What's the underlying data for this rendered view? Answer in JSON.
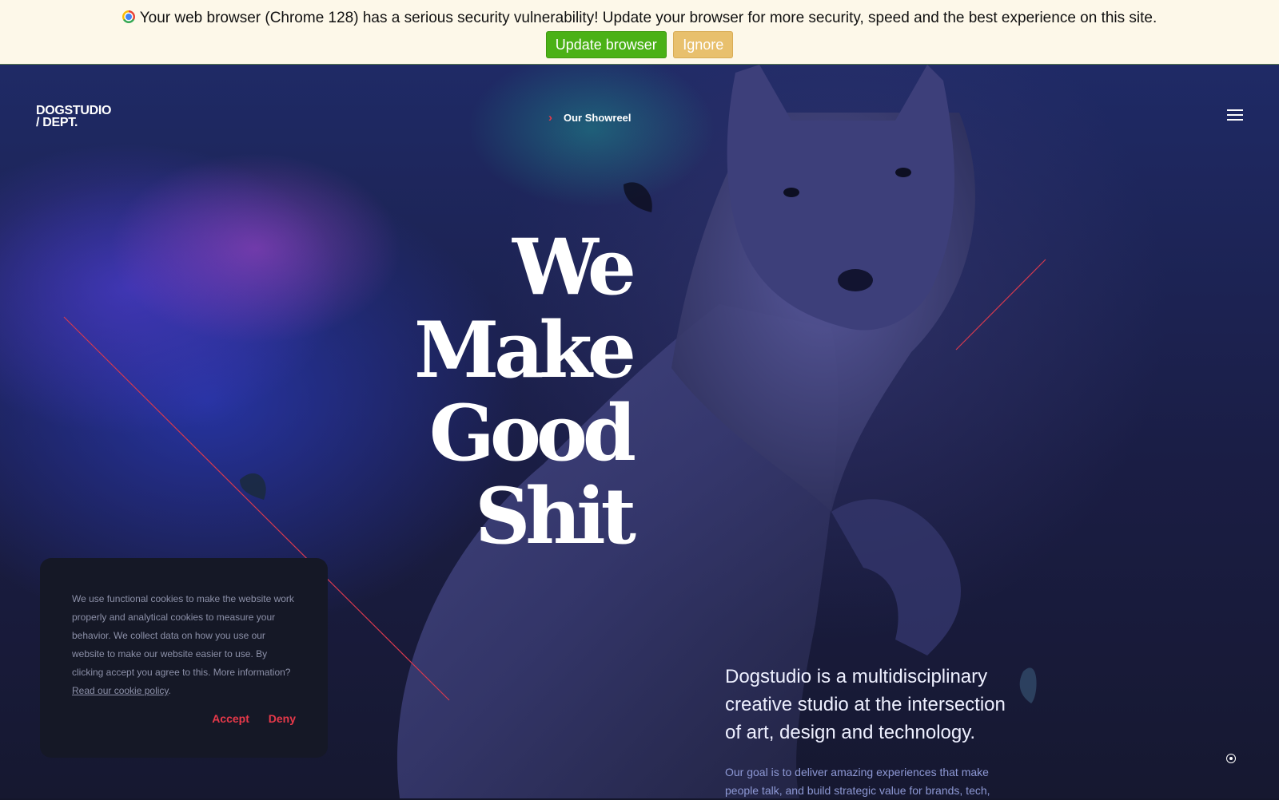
{
  "banner": {
    "message": "Your web browser (Chrome 128) has a serious security vulnerability! Update your browser for more security, speed and the best experience on this site.",
    "update_label": "Update browser",
    "ignore_label": "Ignore"
  },
  "header": {
    "logo_line1": "DOGSTUDIO",
    "logo_line2": "/ DEPT.",
    "showreel_label": "Our Showreel",
    "menu_icon": "hamburger-icon"
  },
  "hero": {
    "headline": [
      "We",
      "Make",
      "Good",
      "Shit"
    ],
    "intro": "Dogstudio is a multidisciplinary creative studio at the intersection of art, design and technology.",
    "sub_text": "Our goal is to deliver amazing experiences that make people talk, and build strategic value for brands, tech,"
  },
  "cookie": {
    "text": "We use functional cookies to make the website work properly and analytical cookies to measure your behavior. We collect data on how you use our website to make our website easier to use. By clicking accept you agree to this. More information?",
    "link_label": "Read our cookie policy",
    "accept_label": "Accept",
    "deny_label": "Deny"
  },
  "colors": {
    "accent": "#e8394a",
    "update_button": "#4bb116",
    "ignore_button": "#e8c06d",
    "banner_bg": "#fdf8e9"
  }
}
